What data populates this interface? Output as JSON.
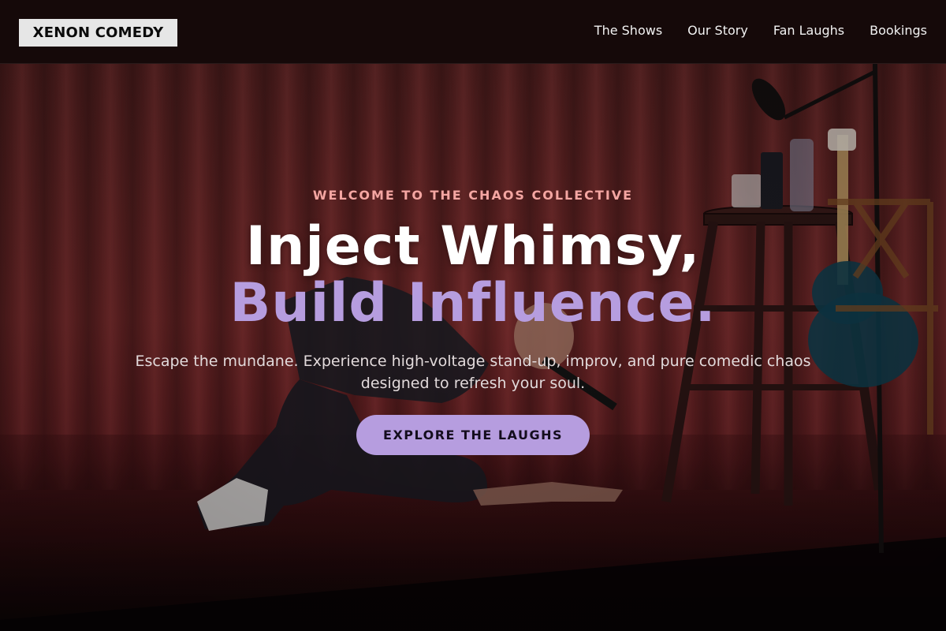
{
  "header": {
    "logo": "XENON COMEDY",
    "nav": [
      {
        "label": "The Shows"
      },
      {
        "label": "Our Story"
      },
      {
        "label": "Fan Laughs"
      },
      {
        "label": "Bookings"
      }
    ]
  },
  "hero": {
    "eyebrow": "WELCOME TO THE CHAOS COLLECTIVE",
    "headline_line1": "Inject Whimsy,",
    "headline_line2": "Build Influence.",
    "subtitle": "Escape the mundane. Experience high-voltage stand-up, improv, and pure comedic chaos designed to refresh your soul.",
    "cta_label": "EXPLORE THE LAUGHS"
  },
  "colors": {
    "accent": "#b69ddf",
    "eyebrow": "#f4a6a2",
    "header_bg": "#150909",
    "logo_bg": "#e6e6e6"
  }
}
